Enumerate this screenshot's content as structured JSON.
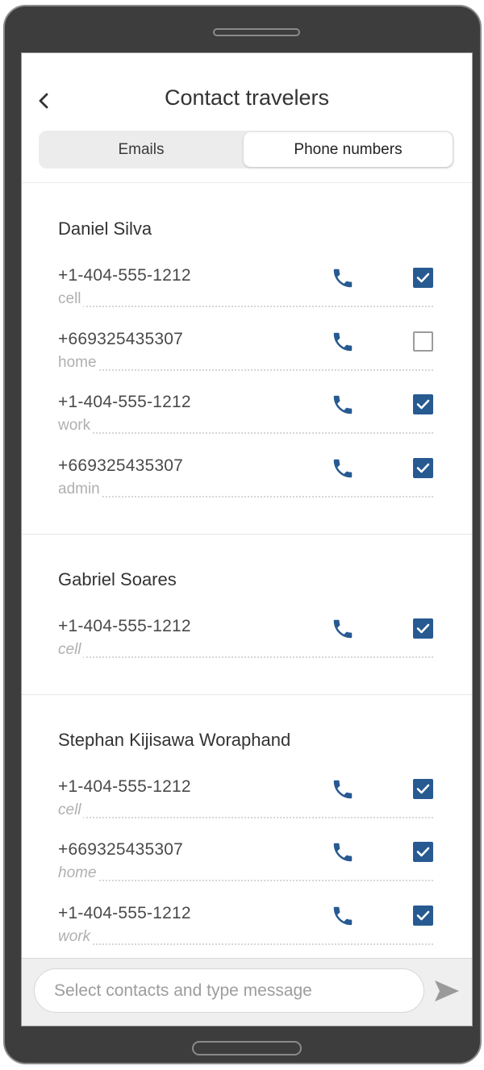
{
  "header": {
    "title": "Contact travelers",
    "back_icon": "chevron-left-icon",
    "tabs": [
      {
        "label": "Emails",
        "selected": false
      },
      {
        "label": "Phone numbers",
        "selected": true
      }
    ]
  },
  "groups": [
    {
      "name": "Daniel Silva",
      "numbers": [
        {
          "phone": "+1-404-555-1212",
          "type": "cell",
          "checked": true
        },
        {
          "phone": "+669325435307",
          "type": "home",
          "checked": false
        },
        {
          "phone": "+1-404-555-1212",
          "type": "work",
          "checked": true
        },
        {
          "phone": "+669325435307",
          "type": "admin",
          "checked": true
        }
      ]
    },
    {
      "name": "Gabriel Soares",
      "numbers": [
        {
          "phone": "+1-404-555-1212",
          "type": "cell",
          "checked": true
        }
      ]
    },
    {
      "name": "Stephan Kijisawa Woraphand",
      "numbers": [
        {
          "phone": "+1-404-555-1212",
          "type": "cell",
          "checked": true
        },
        {
          "phone": "+669325435307",
          "type": "home",
          "checked": true
        },
        {
          "phone": "+1-404-555-1212",
          "type": "work",
          "checked": true
        }
      ]
    }
  ],
  "composer": {
    "placeholder": "Select contacts and type message",
    "send_icon": "send-icon"
  },
  "colors": {
    "accent": "#275a91",
    "device": "#3d3d3d"
  }
}
